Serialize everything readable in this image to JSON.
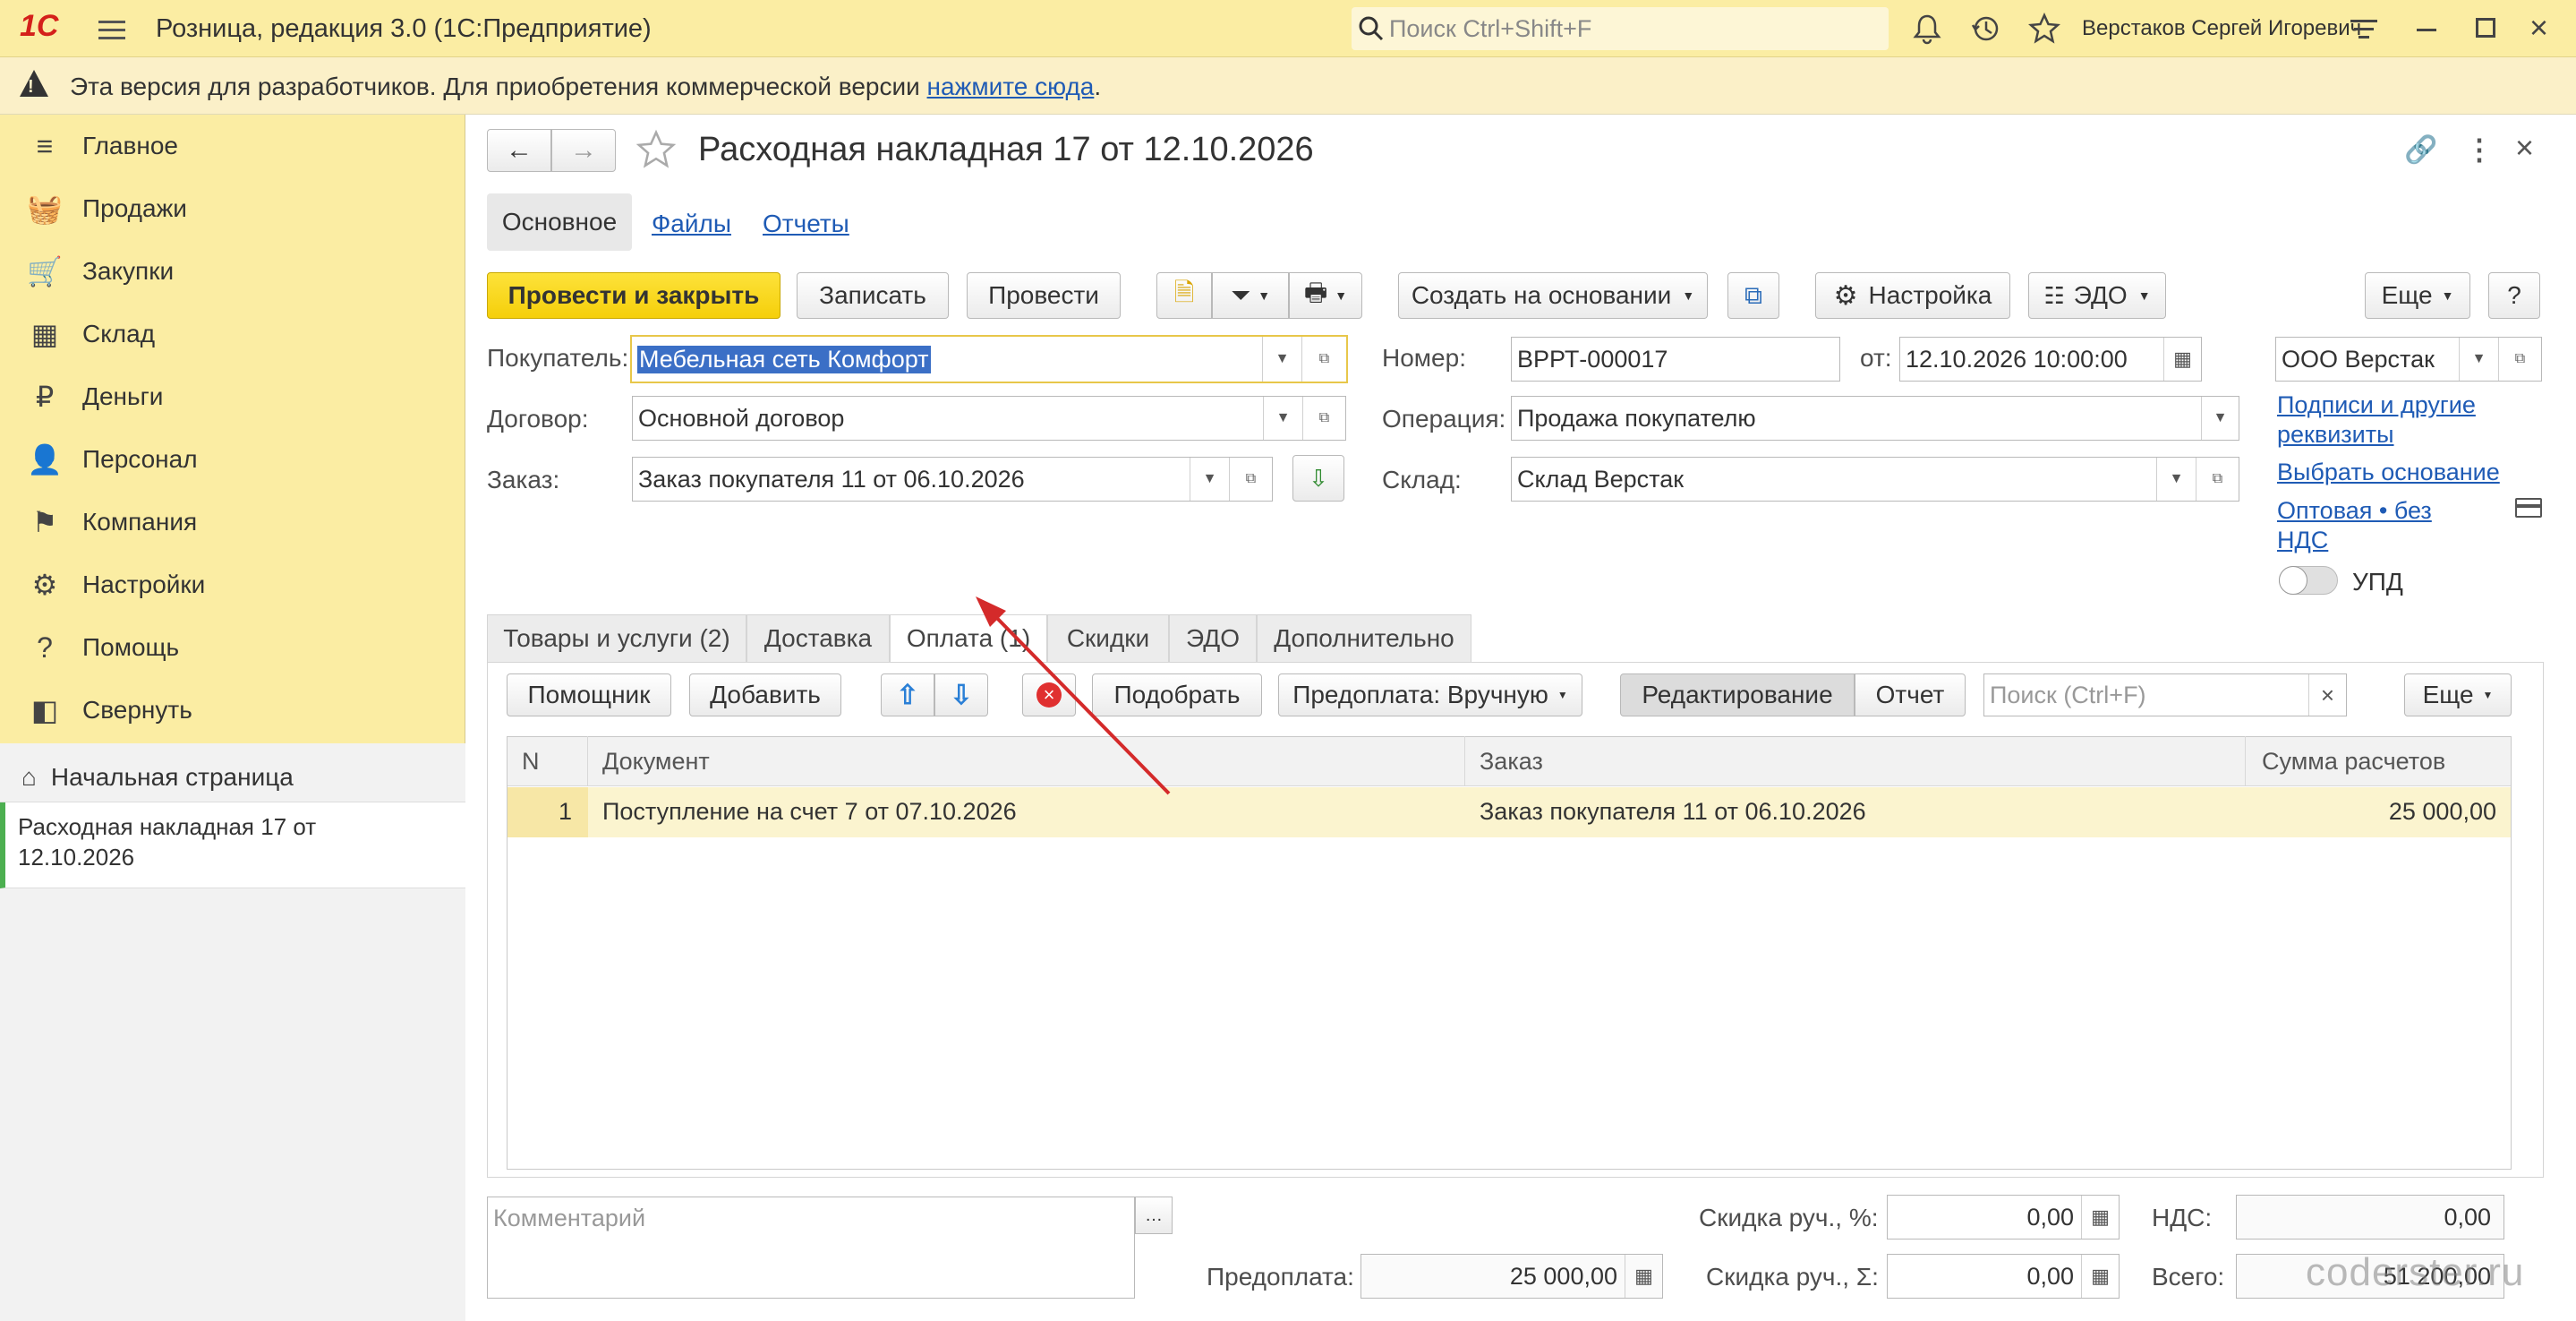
{
  "app": {
    "logo": "1С",
    "title": "Розница, редакция 3.0  (1С:Предприятие)",
    "search_placeholder": "Поиск Ctrl+Shift+F",
    "user": "Верстаков Сергей Игоревич"
  },
  "devbar": {
    "text": "Эта версия для разработчиков. Для приобретения коммерческой версии",
    "link": "нажмите сюда",
    "tail": "."
  },
  "sidebar": {
    "items": [
      {
        "label": "Главное",
        "icon": "menu-icon"
      },
      {
        "label": "Продажи",
        "icon": "basket-icon"
      },
      {
        "label": "Закупки",
        "icon": "cart-icon"
      },
      {
        "label": "Склад",
        "icon": "grid-icon"
      },
      {
        "label": "Деньги",
        "icon": "ruble-icon"
      },
      {
        "label": "Персонал",
        "icon": "person-icon"
      },
      {
        "label": "Компания",
        "icon": "flag-icon"
      },
      {
        "label": "Настройки",
        "icon": "gear-icon"
      },
      {
        "label": "Помощь",
        "icon": "help-icon"
      },
      {
        "label": "Свернуть",
        "icon": "collapse-icon"
      }
    ],
    "home": "Начальная страница",
    "open_doc": "Расходная накладная 17 от 12.10.2026"
  },
  "doc": {
    "title": "Расходная накладная 17 от 12.10.2026",
    "subtabs": [
      "Основное",
      "Файлы",
      "Отчеты"
    ]
  },
  "toolbar": {
    "post_close": "Провести и закрыть",
    "save": "Записать",
    "post": "Провести",
    "create_based": "Создать на основании",
    "settings": "Настройка",
    "edo": "ЭДО",
    "more": "Еще",
    "help": "?"
  },
  "form": {
    "buyer_label": "Покупатель:",
    "buyer": "Мебельная сеть Комфорт",
    "contract_label": "Договор:",
    "contract": "Основной договор",
    "order_label": "Заказ:",
    "order": "Заказ покупателя 11 от 06.10.2026",
    "number_label": "Номер:",
    "number": "ВРРТ-000017",
    "date_label": "от:",
    "date": "12.10.2026 10:00:00",
    "operation_label": "Операция:",
    "operation": "Продажа покупателю",
    "warehouse_label": "Склад:",
    "warehouse": "Склад Верстак",
    "org": "ООО Верстак",
    "link_sign": "Подписи и другие реквизиты",
    "link_basis": "Выбрать основание",
    "link_price": "Оптовая • без НДС",
    "upd": "УПД"
  },
  "tabs": [
    "Товары и услуги (2)",
    "Доставка",
    "Оплата (1)",
    "Скидки",
    "ЭДО",
    "Дополнительно"
  ],
  "pay_toolbar": {
    "assistant": "Помощник",
    "add": "Добавить",
    "pick": "Подобрать",
    "prepay": "Предоплата: Вручную",
    "edit": "Редактирование",
    "report": "Отчет",
    "search_placeholder": "Поиск (Ctrl+F)",
    "more": "Еще"
  },
  "table": {
    "headers": [
      "N",
      "Документ",
      "Заказ",
      "Сумма расчетов"
    ],
    "rows": [
      {
        "n": "1",
        "doc": "Поступление на счет 7 от 07.10.2026",
        "order": "Заказ покупателя 11 от 06.10.2026",
        "sum": "25 000,00"
      }
    ]
  },
  "footer": {
    "comment_placeholder": "Комментарий",
    "prepay_label": "Предоплата:",
    "prepay": "25 000,00",
    "disc_pct_label": "Скидка руч., %:",
    "disc_pct": "0,00",
    "disc_sum_label": "Скидка руч., Σ:",
    "disc_sum": "0,00",
    "vat_label": "НДС:",
    "vat": "0,00",
    "total_label": "Всего:",
    "total": "51 200,00"
  },
  "watermark": "coderster.ru"
}
